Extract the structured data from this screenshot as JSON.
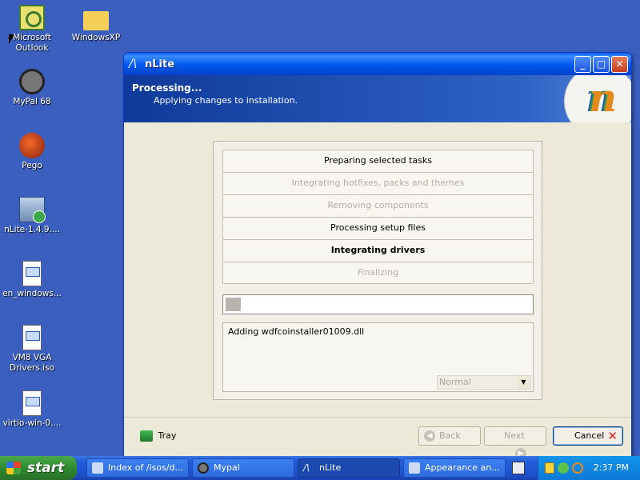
{
  "desktop": {
    "icons": [
      {
        "label": "Microsoft Outlook",
        "icon": "outlook-icon"
      },
      {
        "label": "WindowsXP",
        "icon": "folder-icon"
      },
      {
        "label": "MyPal 68",
        "icon": "mypal-icon"
      },
      {
        "label": "Pego",
        "icon": "pego-icon"
      },
      {
        "label": "nLite-1.4.9....",
        "icon": "installer-icon"
      },
      {
        "label": "en_windows...",
        "icon": "iso-icon"
      },
      {
        "label": "VM8 VGA Drivers.iso",
        "icon": "iso-icon"
      },
      {
        "label": "virtio-win-0....",
        "icon": "iso-icon"
      }
    ]
  },
  "window": {
    "title": "nLite",
    "header_title": "Processing...",
    "header_subtitle": "Applying changes to installation.",
    "steps": [
      {
        "label": "Preparing selected tasks",
        "state": "done"
      },
      {
        "label": "Integrating hotfixes, packs and themes",
        "state": "skipped"
      },
      {
        "label": "Removing components",
        "state": "skipped"
      },
      {
        "label": "Processing setup files",
        "state": "done"
      },
      {
        "label": "Integrating drivers",
        "state": "current"
      },
      {
        "label": "Finalizing",
        "state": "pending"
      }
    ],
    "progress_fraction": 0.05,
    "log_line": "Adding wdfcoinstaller01009.dll",
    "priority_select": "Normal",
    "footer": {
      "tray_label": "Tray",
      "back_label": "Back",
      "next_label": "Next",
      "cancel_label": "Cancel"
    }
  },
  "taskbar": {
    "start_label": "start",
    "tasks": [
      {
        "label": "Index of /isos/d...",
        "icon": "browser-icon",
        "active": false
      },
      {
        "label": "Mypal",
        "icon": "mypal-icon",
        "active": false
      },
      {
        "label": "nLite",
        "icon": "nlite-icon",
        "active": true
      },
      {
        "label": "Appearance an...",
        "icon": "appearance-icon",
        "active": false
      }
    ],
    "clock": "2:37 PM"
  }
}
